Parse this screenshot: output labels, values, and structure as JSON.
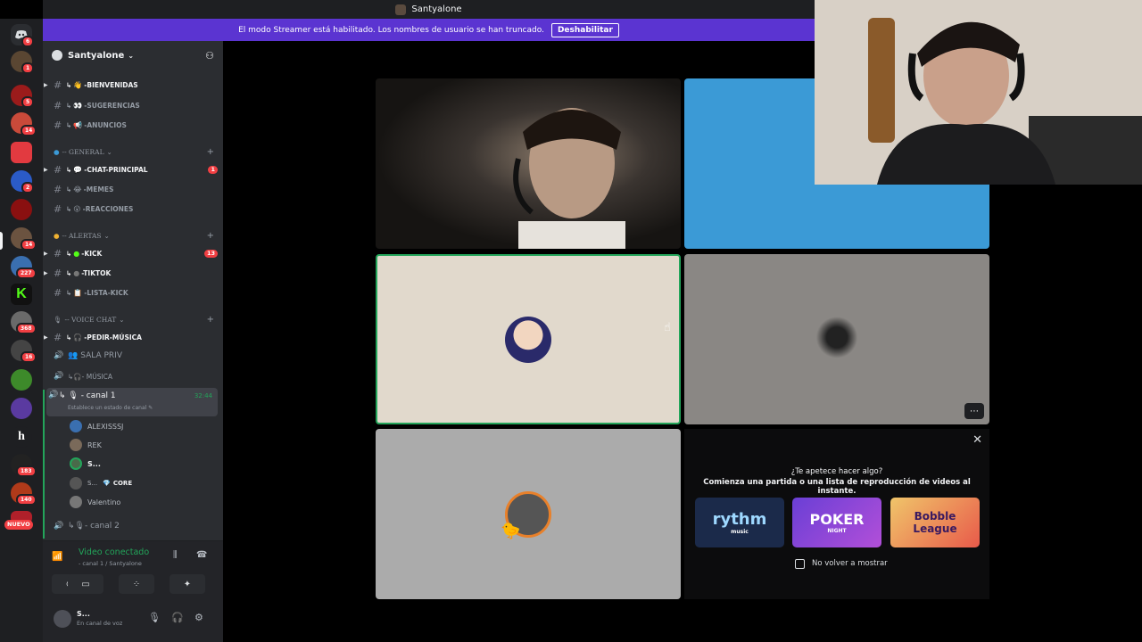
{
  "window": {
    "title": "Santyalone"
  },
  "banner": {
    "text": "El modo Streamer está habilitado. Los nombres de usuario se han truncado.",
    "disable_label": "Deshabilitar"
  },
  "rail": {
    "badges": [
      "6",
      "1",
      "5",
      "14",
      "2",
      "14",
      "227",
      "368",
      "16",
      "183",
      "140"
    ],
    "new_label": "NUEVO"
  },
  "server": {
    "name": "Santyalone"
  },
  "channels": {
    "bienvenidas": "-BIENVENIDAS",
    "sugerencias": "-SUGERENCIAS",
    "anuncios": "-ANUNCIOS",
    "cat_general": "-- GENERAL",
    "chat_principal": "-CHAT-PRINCIPAL",
    "chat_principal_count": "1",
    "memes": "-MEMES",
    "reacciones": "-REACCIONES",
    "cat_alertas": "-- ALERTAS",
    "kick": "-KICK",
    "kick_count": "13",
    "tiktok": "-TIKTOK",
    "lista_kick": "-LISTA-KICK",
    "cat_voice": "-- VOICE CHAT",
    "pedir_musica": "-PEDIR-MÚSICA",
    "sala_priv": "SALA PRIV",
    "musica": "- MÚSICA",
    "canal1": "- canal 1",
    "canal1_time": "32:44",
    "canal1_status": "Establece un estado de canal",
    "canal2": "- canal 2"
  },
  "voice_users": [
    {
      "name": "ALEXISSSJ",
      "tag": ""
    },
    {
      "name": "REK",
      "tag": ""
    },
    {
      "name": "S...",
      "tag": ""
    },
    {
      "name": "S...",
      "tag": "CORE"
    },
    {
      "name": "Valentino",
      "tag": ""
    }
  ],
  "voice_panel": {
    "status": "Video conectado",
    "location": "- canal 1 / Santyalone"
  },
  "user_panel": {
    "name": "S...",
    "status": "En canal de voz"
  },
  "promo": {
    "question": "¿Te apetece hacer algo?",
    "description": "Comienza una partida o una lista de reproducción de videos al instante.",
    "cards": [
      {
        "name": "rythm",
        "sub": "music",
        "color": "#1b2a4a"
      },
      {
        "name": "POKER",
        "sub": "NIGHT",
        "color": "#6a3fd6"
      },
      {
        "name": "Bobble",
        "sub": "League",
        "color": "#f0c56a"
      }
    ],
    "dont_show": "No volver a mostrar"
  },
  "colors": {
    "accent": "#5b34d1",
    "online": "#23a55a",
    "alert": "#f23f43",
    "tile_blue": "#3b9ad6"
  }
}
